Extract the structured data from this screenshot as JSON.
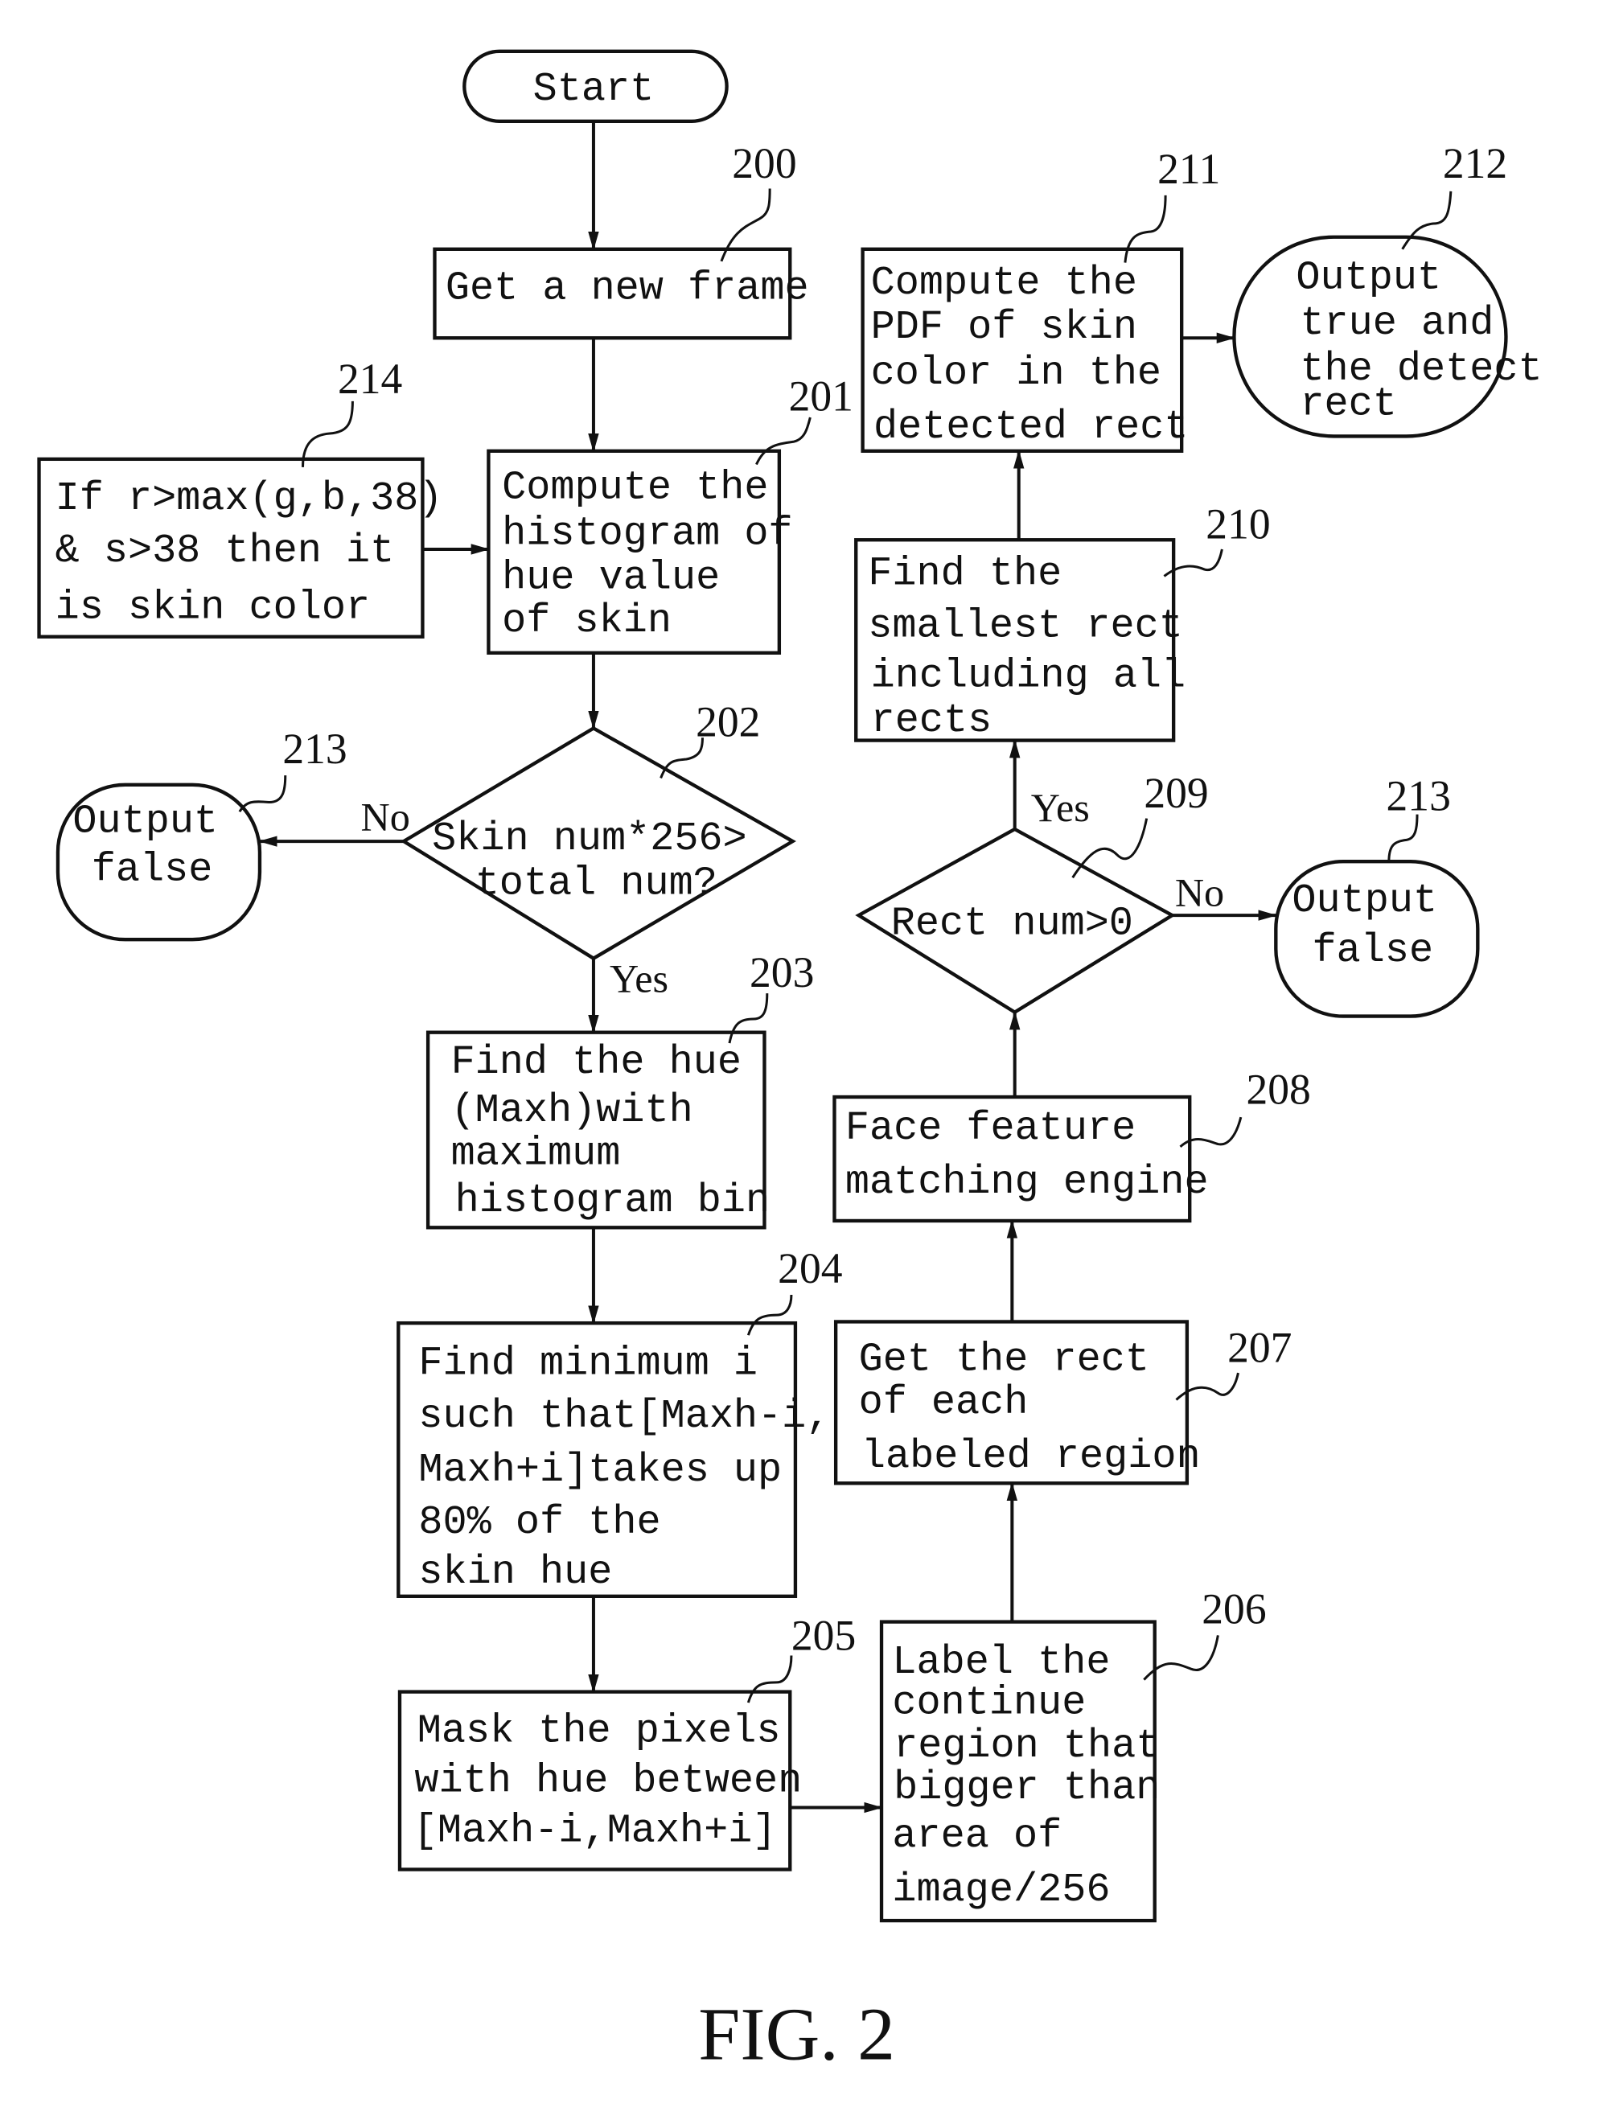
{
  "figure_label": "FIG. 2",
  "nodes": {
    "start": {
      "ref": "",
      "lines": [
        "Start"
      ]
    },
    "n200": {
      "ref": "200",
      "lines": [
        "Get a new frame"
      ]
    },
    "n201": {
      "ref": "201",
      "lines": [
        "Compute the",
        "histogram of",
        "hue value",
        "of skin"
      ]
    },
    "n214": {
      "ref": "214",
      "lines": [
        "If r>max(g,b,38)",
        "& s>38 then it",
        "is skin color"
      ]
    },
    "n202": {
      "ref": "202",
      "lines": [
        "Skin num*256>",
        "total num?"
      ]
    },
    "n213a": {
      "ref": "213",
      "lines": [
        "Output",
        "false"
      ]
    },
    "n203": {
      "ref": "203",
      "lines": [
        "Find the hue",
        "(Maxh)with",
        "maximum",
        "histogram bin"
      ]
    },
    "n204": {
      "ref": "204",
      "lines": [
        "Find minimum i",
        "such that[Maxh-i,",
        "Maxh+i]takes up",
        "80% of the",
        "skin hue"
      ]
    },
    "n205": {
      "ref": "205",
      "lines": [
        "Mask the pixels",
        "with hue between",
        "[Maxh-i,Maxh+i]"
      ]
    },
    "n206": {
      "ref": "206",
      "lines": [
        "Label the",
        "continue",
        "region that",
        "bigger than",
        "area of",
        "image/256"
      ]
    },
    "n207": {
      "ref": "207",
      "lines": [
        "Get the rect",
        "of each",
        "labeled region"
      ]
    },
    "n208": {
      "ref": "208",
      "lines": [
        "Face feature",
        "matching engine"
      ]
    },
    "n209": {
      "ref": "209",
      "lines": [
        "Rect num>0"
      ]
    },
    "n213b": {
      "ref": "213",
      "lines": [
        "Output",
        "false"
      ]
    },
    "n210": {
      "ref": "210",
      "lines": [
        "Find the",
        "smallest rect",
        "including all",
        "rects"
      ]
    },
    "n211": {
      "ref": "211",
      "lines": [
        "Compute the",
        "PDF of skin",
        "color in the",
        "detected rect"
      ]
    },
    "n212": {
      "ref": "212",
      "lines": [
        "Output",
        "true and",
        "the detect",
        "rect"
      ]
    }
  },
  "edge_labels": {
    "n202_no": "No",
    "n202_yes": "Yes",
    "n209_no": "No",
    "n209_yes": "Yes"
  }
}
